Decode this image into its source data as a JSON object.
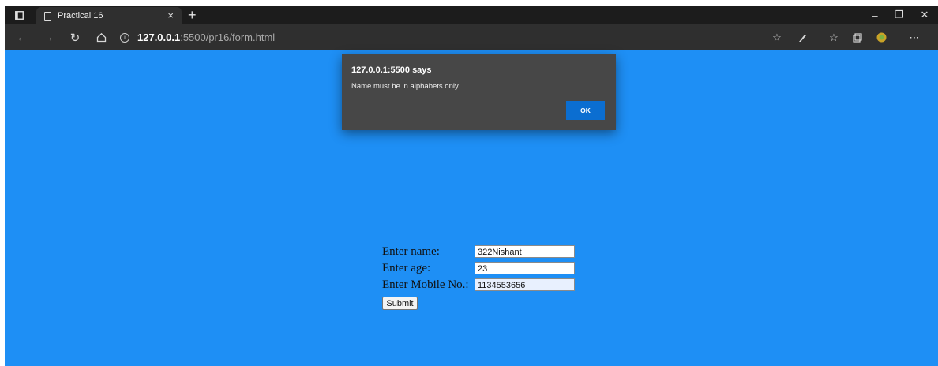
{
  "browser": {
    "tab": {
      "title": "Practical 16",
      "close_glyph": "×"
    },
    "new_tab_glyph": "+",
    "address": {
      "host": "127.0.0.1",
      "rest": ":5500/pr16/form.html"
    },
    "window_controls": {
      "minimize": "–",
      "restore": "❐",
      "close": "✕"
    },
    "toolbar_icons": [
      "favorite-add-icon",
      "read-aloud-icon",
      "favorites-icon",
      "collections-icon",
      "extension-icon",
      "more-icon"
    ]
  },
  "alert": {
    "title": "127.0.0.1:5500 says",
    "message": "Name must be in alphabets only",
    "ok_label": "OK"
  },
  "form": {
    "name_label": "Enter name:",
    "name_value": "322Nishant",
    "age_label": "Enter age:",
    "age_value": "23",
    "mobile_label": "Enter Mobile No.:",
    "mobile_value": "1134553656",
    "submit_label": "Submit"
  },
  "colors": {
    "page_background": "#1e8ff5",
    "ok_button": "#0b6ed1",
    "dialog": "#474747"
  }
}
